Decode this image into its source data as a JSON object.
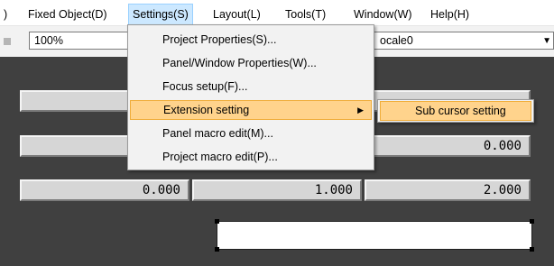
{
  "menubar": {
    "items": [
      {
        "label": ")"
      },
      {
        "label": "Fixed Object(D)"
      },
      {
        "label": "Settings(S)"
      },
      {
        "label": "Layout(L)"
      },
      {
        "label": "Tools(T)"
      },
      {
        "label": "Window(W)"
      },
      {
        "label": "Help(H)"
      }
    ]
  },
  "toolbar": {
    "zoom_value": "100%",
    "scale_value": "ocale0"
  },
  "settings_menu": {
    "items": [
      {
        "label": "Project Properties(S)..."
      },
      {
        "label": "Panel/Window Properties(W)..."
      },
      {
        "label": "Focus setup(F)..."
      },
      {
        "label": "Extension setting"
      },
      {
        "label": "Panel macro edit(M)..."
      },
      {
        "label": "Project macro edit(P)..."
      }
    ],
    "submenu_arrow": "▶"
  },
  "extension_submenu": {
    "items": [
      {
        "label": "Sub cursor setting"
      }
    ]
  },
  "panel": {
    "fields": [
      {
        "value": ""
      },
      {
        "value": ""
      },
      {
        "value": "0.000"
      },
      {
        "value": "0.000"
      },
      {
        "value": "1.000"
      },
      {
        "value": "2.000"
      }
    ]
  },
  "colors": {
    "panel_bg": "#404040",
    "field_bg": "#d6d6d6",
    "menu_highlight": "#ffd38c",
    "menubar_active": "#cce8ff"
  }
}
